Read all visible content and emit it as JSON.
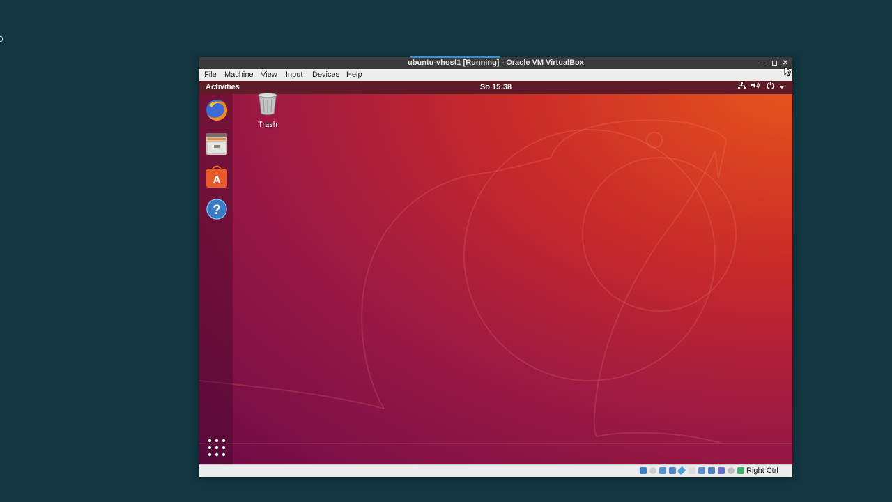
{
  "window": {
    "title": "ubuntu-vhost1 [Running] - Oracle VM VirtualBox",
    "controls": {
      "minimize": "–",
      "maximize": "□",
      "close": "✕"
    }
  },
  "menubar": {
    "items": [
      "File",
      "Machine",
      "View",
      "Input",
      "Devices",
      "Help"
    ]
  },
  "guest": {
    "topbar": {
      "activities": "Activities",
      "clock": "So 15:38",
      "tray": {
        "network_icon": "network-wired-icon",
        "volume_icon": "volume-icon",
        "power_icon": "power-icon",
        "menu_arrow": "chevron-down-icon"
      }
    },
    "dock": {
      "items": [
        "firefox-icon",
        "files-icon",
        "software-center-icon",
        "help-icon"
      ],
      "show_apps_icon": "app-grid-icon"
    },
    "desktop": {
      "trash_label": "Trash"
    },
    "colors": {
      "topbar": "#5d1c26",
      "wallpaper_orange": "#e9541c",
      "wallpaper_purple": "#6e0b47"
    }
  },
  "statusbar": {
    "host_key": "Right Ctrl",
    "icons": [
      "hard-disk-icon",
      "optical-drive-icon",
      "audio-icon",
      "network-icon",
      "usb-icon",
      "shared-folders-icon",
      "display-icon",
      "video-capture-icon",
      "cpu-icon",
      "mouse-integration-icon",
      "host-key-icon"
    ]
  }
}
